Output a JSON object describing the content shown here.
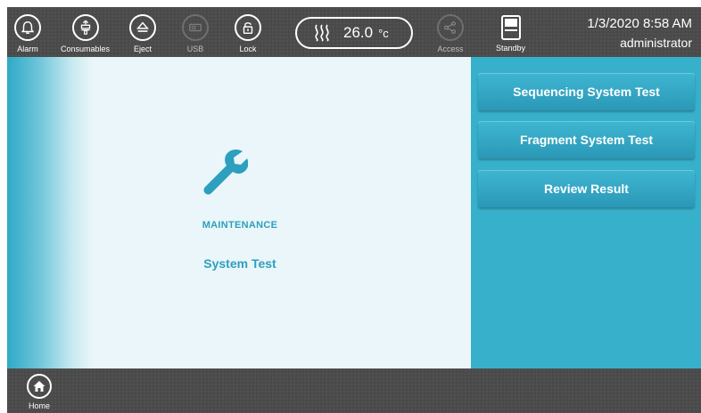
{
  "toolbar": {
    "alarm_label": "Alarm",
    "consumables_label": "Consumables",
    "eject_label": "Eject",
    "usb_label": "USB",
    "lock_label": "Lock",
    "temperature_value": "26.0",
    "temperature_unit": "°c",
    "access_label": "Access",
    "standby_label": "Standby",
    "datetime": "1/3/2020 8:58 AM",
    "user": "administrator"
  },
  "main": {
    "section_title": "MAINTENANCE",
    "heading": "System Test"
  },
  "side": {
    "buttons": [
      {
        "label": "Sequencing System Test"
      },
      {
        "label": "Fragment System Test"
      },
      {
        "label": "Review Result"
      }
    ]
  },
  "bottombar": {
    "home_label": "Home"
  },
  "colors": {
    "accent": "#37b0cc",
    "text_accent": "#2d9fbf",
    "toolbar_bg": "#4a4a4a",
    "main_bg": "#eaf6f9"
  },
  "icons": [
    "bell-icon",
    "consumables-icon",
    "eject-icon",
    "usb-icon",
    "lock-icon",
    "heat-icon",
    "share-icon",
    "standby-icon",
    "wrench-icon",
    "home-icon"
  ]
}
